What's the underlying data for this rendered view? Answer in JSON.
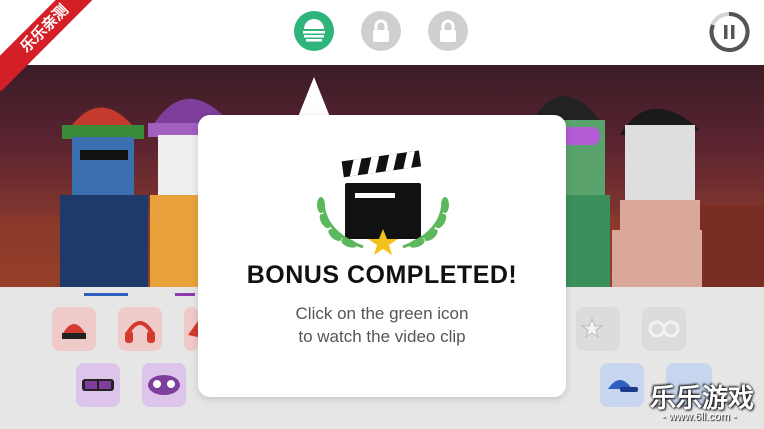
{
  "top_bar": {
    "bonus_icon": "green-stripes-circle-icon",
    "locked_icon": "lock-icon",
    "pause_icon": "pause-icon"
  },
  "modal": {
    "title": "BONUS COMPLETED!",
    "line1": "Click on the green icon",
    "line2": "to watch the video clip",
    "icon": "clapperboard-icon",
    "decoration": "laurel-star-icon"
  },
  "watermark": {
    "corner_tag": "乐乐亲测",
    "brand": "乐乐游戏",
    "url": "- www.6ll.com -"
  },
  "colors": {
    "accent_green": "#2fb47c",
    "lock_gray": "#cfcfcf",
    "laurel_green": "#5cb85c",
    "star_gold": "#f4c21a",
    "watermark_red": "#d41f26"
  },
  "sounds": [
    {
      "icon": "red-beanie-icon"
    },
    {
      "icon": "red-headphones-icon"
    },
    {
      "icon": "red-hat-icon"
    },
    {
      "icon": "stars-icon"
    },
    {
      "icon": "glasses-icon"
    },
    {
      "icon": "purple-shades-icon"
    },
    {
      "icon": "purple-mask-icon"
    },
    {
      "icon": "blue-cap-icon"
    }
  ]
}
